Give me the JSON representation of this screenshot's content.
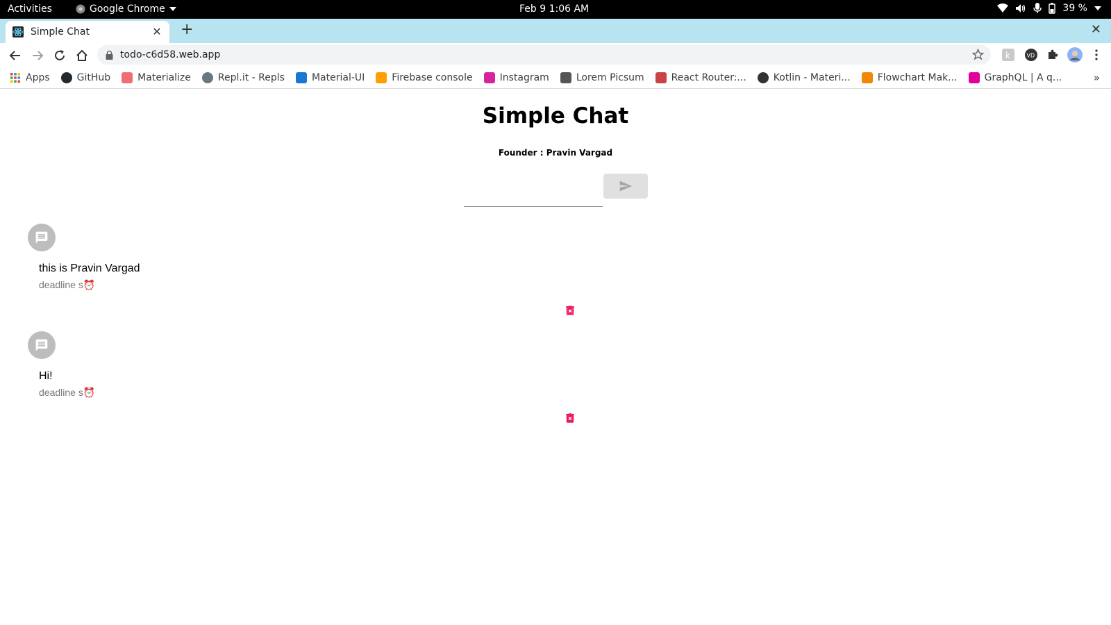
{
  "system_bar": {
    "activities": "Activities",
    "app_name": "Google Chrome",
    "clock": "Feb 9  1:06 AM",
    "battery": "39 %"
  },
  "browser": {
    "tab_title": "Simple Chat",
    "url": "todo-c6d58.web.app",
    "bookmarks": [
      {
        "label": "Apps",
        "color": "#4285f4"
      },
      {
        "label": "GitHub",
        "color": "#24292e"
      },
      {
        "label": "Materialize",
        "color": "#ee6e73"
      },
      {
        "label": "Repl.it - Repls",
        "color": "#667881"
      },
      {
        "label": "Material-UI",
        "color": "#1976d2"
      },
      {
        "label": "Firebase console",
        "color": "#ffa000"
      },
      {
        "label": "Instagram",
        "color": "#d6249f"
      },
      {
        "label": "Lorem Picsum",
        "color": "#555555"
      },
      {
        "label": "React Router:...",
        "color": "#ca4245"
      },
      {
        "label": "Kotlin - Materi...",
        "color": "#333333"
      },
      {
        "label": "Flowchart Mak...",
        "color": "#f08705"
      },
      {
        "label": "GraphQL | A q...",
        "color": "#e10098"
      }
    ]
  },
  "app": {
    "title": "Simple Chat",
    "subtitle": "Founder : Pravin Vargad",
    "input_value": "",
    "messages": [
      {
        "text": "this is Pravin Vargad",
        "meta": "deadline s⏰"
      },
      {
        "text": "Hi!",
        "meta": "deadline s⏰"
      }
    ]
  },
  "colors": {
    "delete": "#e91e63",
    "avatar": "#bdbdbd",
    "tabstrip": "#b8e4f2"
  }
}
